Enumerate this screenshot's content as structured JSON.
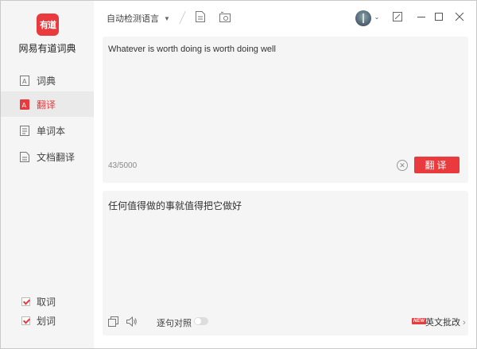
{
  "app": {
    "logo_text": "有道",
    "name": "网易有道词典"
  },
  "sidebar": {
    "items": [
      {
        "label": "词典",
        "icon": "dictionary-icon"
      },
      {
        "label": "翻译",
        "icon": "translate-icon",
        "active": true
      },
      {
        "label": "单词本",
        "icon": "wordbook-icon"
      },
      {
        "label": "文档翻译",
        "icon": "document-icon"
      }
    ],
    "options": [
      {
        "label": "取词",
        "checked": true
      },
      {
        "label": "划词",
        "checked": true
      }
    ]
  },
  "toolbar": {
    "language": "自动检测语言"
  },
  "input": {
    "text": "Whatever is worth doing is worth doing well",
    "counter": "43/5000",
    "translate_label": "翻译"
  },
  "output": {
    "text": "任何值得做的事就值得把它做好",
    "compare_label": "逐句对照",
    "badge": "NEW",
    "correct_label": "英文批改",
    "correct_arrow": "›"
  },
  "colors": {
    "accent": "#e93b3d",
    "panel": "#f5f5f5",
    "sidebar": "#f5f5f5"
  }
}
